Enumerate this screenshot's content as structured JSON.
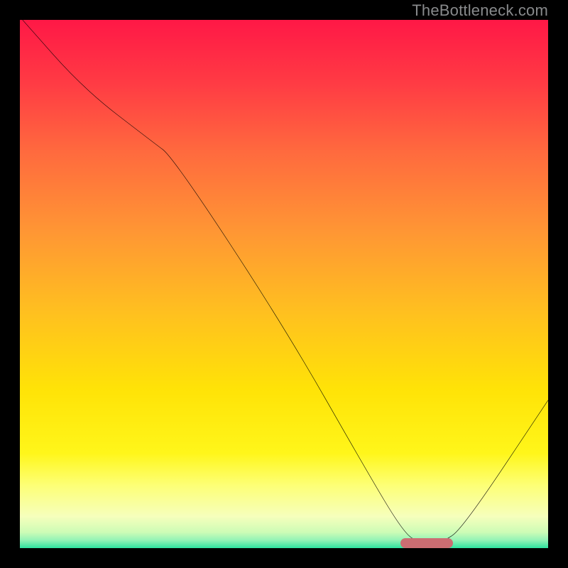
{
  "watermark": "TheBottleneck.com",
  "gradient_stops": [
    {
      "offset": 0.0,
      "color": "#ff1846"
    },
    {
      "offset": 0.12,
      "color": "#ff3b44"
    },
    {
      "offset": 0.25,
      "color": "#ff6a3e"
    },
    {
      "offset": 0.4,
      "color": "#ff9634"
    },
    {
      "offset": 0.55,
      "color": "#ffbf20"
    },
    {
      "offset": 0.7,
      "color": "#ffe307"
    },
    {
      "offset": 0.82,
      "color": "#fff61a"
    },
    {
      "offset": 0.88,
      "color": "#fdff75"
    },
    {
      "offset": 0.94,
      "color": "#f6ffbc"
    },
    {
      "offset": 0.97,
      "color": "#cdfcb6"
    },
    {
      "offset": 0.985,
      "color": "#93f3b6"
    },
    {
      "offset": 1.0,
      "color": "#2ee39f"
    }
  ],
  "chart_data": {
    "type": "line",
    "title": "",
    "xlabel": "",
    "ylabel": "",
    "xlim": [
      0,
      100
    ],
    "ylim": [
      0,
      100
    ],
    "grid": false,
    "series": [
      {
        "name": "curve",
        "x": [
          0.5,
          12,
          25,
          29,
          50,
          66,
          72,
          75,
          80,
          84,
          100
        ],
        "values": [
          100,
          87,
          77,
          74,
          42,
          14,
          4,
          1,
          1,
          4,
          28
        ]
      }
    ],
    "marker": {
      "x_start": 72,
      "x_end": 82,
      "y": 1.0
    }
  }
}
